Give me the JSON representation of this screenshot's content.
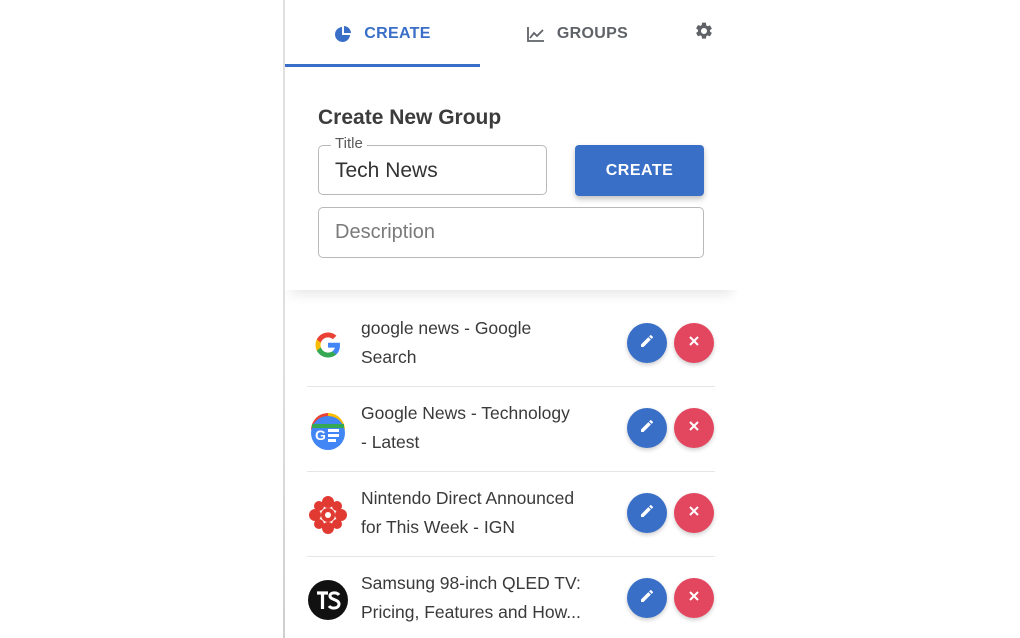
{
  "tabs": {
    "create": {
      "label": "CREATE",
      "icon": "pie-chart-icon"
    },
    "groups": {
      "label": "GROUPS",
      "icon": "line-chart-icon"
    },
    "settings_icon": "gear-icon",
    "active": "create"
  },
  "form": {
    "heading": "Create New Group",
    "title_label": "Title",
    "title_value": "Tech News",
    "description_placeholder": "Description",
    "create_button": "CREATE"
  },
  "items": [
    {
      "line1": "google news - Google",
      "line2": "Search",
      "icon": "google-g-icon"
    },
    {
      "line1": "Google News - Technology",
      "line2": "- Latest",
      "icon": "google-news-icon"
    },
    {
      "line1": "Nintendo Direct Announced",
      "line2": "for This Week - IGN",
      "icon": "ign-icon"
    },
    {
      "line1": "Samsung 98-inch QLED TV:",
      "line2": "Pricing, Features and How...",
      "icon": "ts-icon"
    }
  ],
  "colors": {
    "primary": "#3a6fc7",
    "danger": "#e2475f",
    "text": "#3a3a3a",
    "muted": "#5f6368"
  }
}
